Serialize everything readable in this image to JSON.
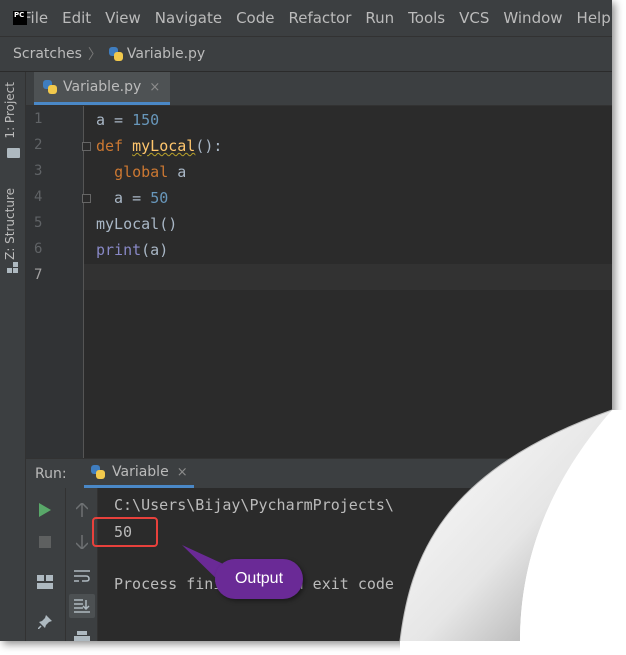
{
  "app": {
    "logo_text": "PC",
    "menu": [
      "File",
      "Edit",
      "View",
      "Navigate",
      "Code",
      "Refactor",
      "Run",
      "Tools",
      "VCS",
      "Window",
      "Help"
    ]
  },
  "breadcrumb": {
    "root": "Scratches",
    "file": "Variable.py"
  },
  "sidebar": {
    "project_tab": "1: Project",
    "structure_tab": "Z: Structure"
  },
  "editor": {
    "tab_label": "Variable.py",
    "tab_close": "×",
    "line_numbers": [
      "1",
      "2",
      "3",
      "4",
      "5",
      "6",
      "7"
    ],
    "lines": [
      [
        "a = ",
        "150"
      ],
      [
        "def",
        " ",
        "myLocal",
        "():"
      ],
      [
        "  ",
        "global",
        " a"
      ],
      [
        "  a = ",
        "50"
      ],
      [
        "myLocal()"
      ],
      [
        "print",
        "(a)"
      ],
      [
        ""
      ]
    ]
  },
  "run_panel": {
    "label": "Run:",
    "tab_label": "Variable",
    "tab_close": "×",
    "console": {
      "path_line": "C:\\Users\\Bijay\\PycharmProjects\\",
      "output": "50",
      "process_line": "Process finished with exit code"
    }
  },
  "annotation": {
    "bubble_text": "Output",
    "box_color": "#e8413c",
    "bubble_color": "#6a2a96"
  },
  "colors": {
    "background": "#2b2b2b",
    "panel": "#3c3f41",
    "keyword": "#cc7832",
    "number": "#6897bb",
    "function": "#ffc66d",
    "builtin": "#8888c6",
    "text": "#a9b7c6",
    "accent": "#4a88c7"
  }
}
